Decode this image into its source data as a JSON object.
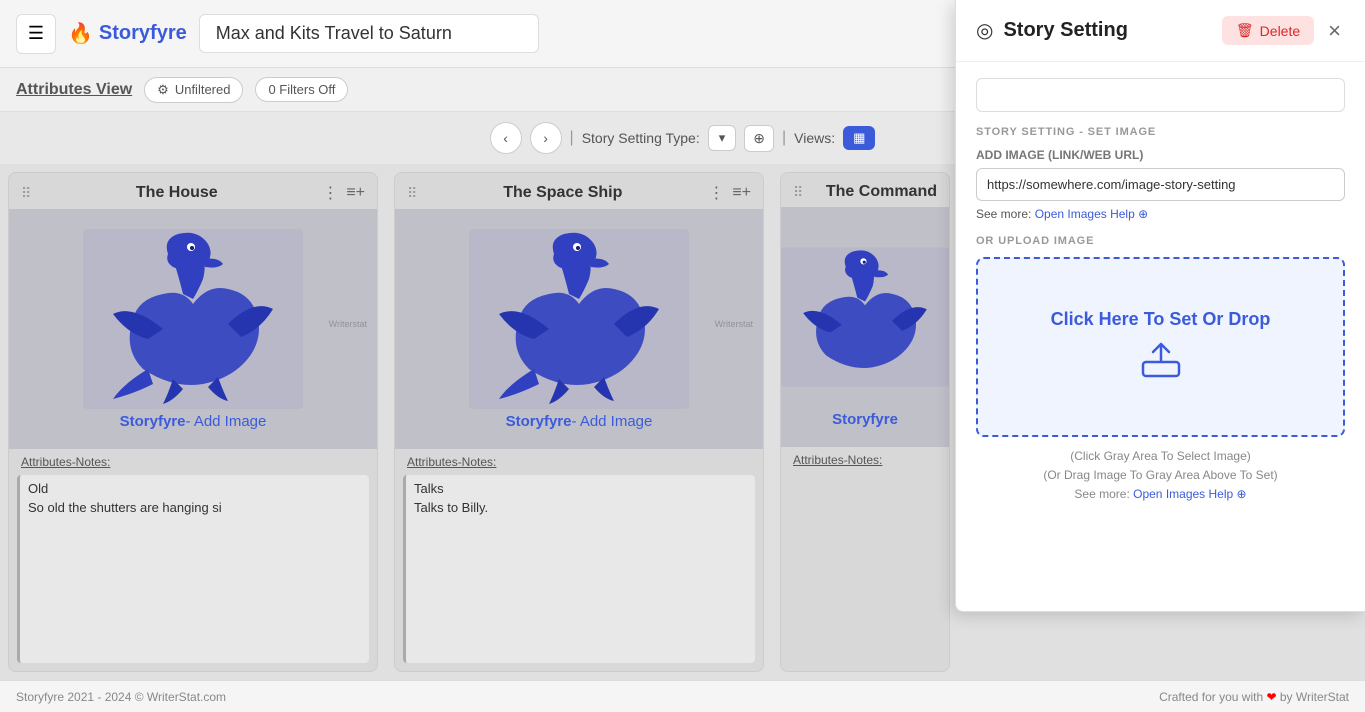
{
  "header": {
    "menu_label": "☰",
    "brand_icon": "🔥",
    "brand_name": "Storyfyre",
    "story_title": "Max and Kits Travel to Saturn"
  },
  "sub_header": {
    "attributes_view_label": "Attributes View",
    "filter_label": "Unfiltered",
    "filters_off_label": "0 Filters Off"
  },
  "toolbar": {
    "prev_icon": "‹",
    "next_icon": "›",
    "separator": "|",
    "setting_type_label": "Story Setting Type:",
    "dropdown_icon": "▾",
    "share_icon": "⊕",
    "views_label": "Views:",
    "views_icon": "▦"
  },
  "cards": [
    {
      "title": "The House",
      "add_image_text": "Storyfyre- Add Image",
      "notes_label": "Attributes-Notes:",
      "notes": [
        "Old",
        "So old the shutters are hanging si"
      ]
    },
    {
      "title": "The Space Ship",
      "add_image_text": "Storyfyre- Add Image",
      "notes_label": "Attributes-Notes:",
      "notes": [
        "Talks",
        "Talks to Billy."
      ]
    },
    {
      "title": "The Command",
      "add_image_text": "Storyfyre",
      "notes_label": "Attributes-Notes:",
      "notes": []
    }
  ],
  "side_panel": {
    "icon": "◎",
    "title": "Story Setting",
    "delete_label": "Delete",
    "close_icon": "×",
    "section_label": "STORY SETTING - SET IMAGE",
    "sub_section_label": "ADD IMAGE (LINK/WEB URL)",
    "url_value": "https://somewhere.com/image-story-setting",
    "help_text_1": "See more:",
    "help_link_1": "Open Images Help",
    "or_upload_label": "OR UPLOAD IMAGE",
    "upload_text": "Click Here To Set Or Drop",
    "upload_icon": "⬆",
    "hint_line1": "(Click Gray Area To Select Image)",
    "hint_line2": "(Or Drag Image To Gray Area Above To Set)",
    "hint_see_more": "See more:",
    "hint_link": "Open Images Help"
  },
  "footer": {
    "left_text": "Storyfyre 2021 - 2024 © WriterStat.com",
    "heart": "❤",
    "right_text": "Crafted for you with  by WriterStat"
  }
}
